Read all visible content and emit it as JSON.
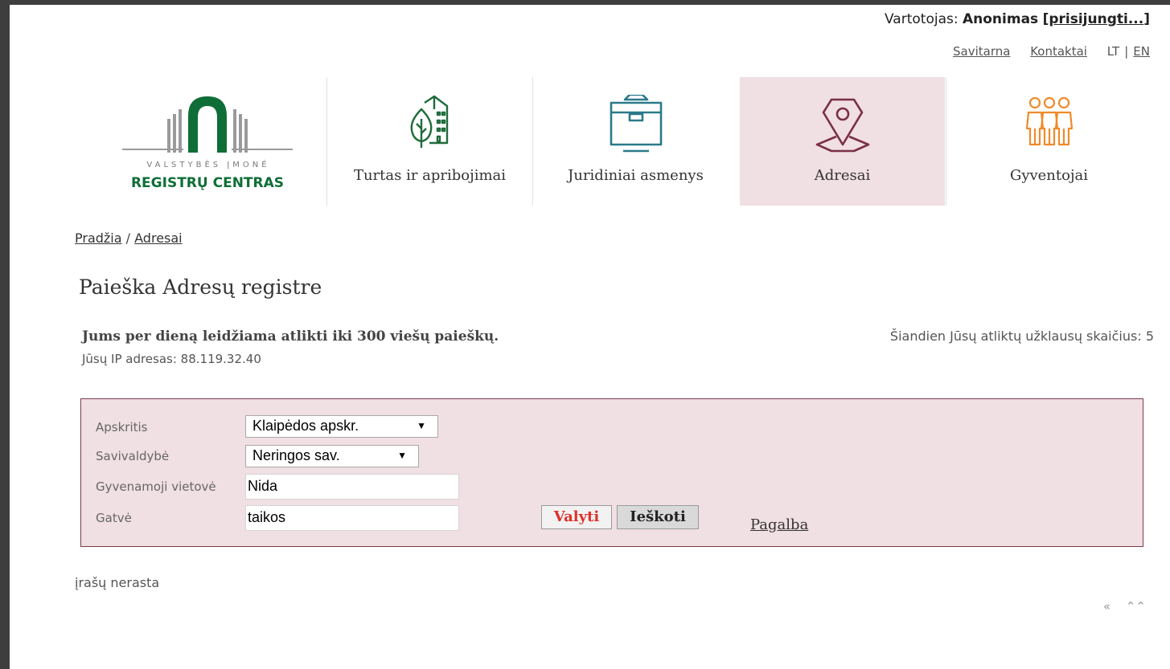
{
  "header": {
    "user_prefix": "Vartotojas:",
    "user_name": "Anonimas",
    "login_link": "prisijungti...",
    "links": {
      "self_service": "Savitarna",
      "contacts": "Kontaktai"
    },
    "lang": {
      "lt": "LT",
      "sep": "|",
      "en": "EN"
    }
  },
  "logo": {
    "line1": "VALSTYBĖS ĮMONĖ",
    "line2": "REGISTRŲ CENTRAS",
    "color": "#0f6e37"
  },
  "nav": [
    {
      "label": "Turtas ir apribojimai",
      "icon": "building-tree-icon",
      "color": "#1e6b3a"
    },
    {
      "label": "Juridiniai asmenys",
      "icon": "briefcase-icon",
      "color": "#2a7a8a"
    },
    {
      "label": "Adresai",
      "icon": "map-pin-icon",
      "color": "#7a2f45",
      "active": true
    },
    {
      "label": "Gyventojai",
      "icon": "people-icon",
      "color": "#f08a2a"
    }
  ],
  "breadcrumb": {
    "home": "Pradžia",
    "sep": "/",
    "current": "Adresai"
  },
  "page_title": "Paieška Adresų registre",
  "info": {
    "limit": "Jums per dieną leidžiama atlikti iki 300 viešų paieškų.",
    "ip": "Jūsų IP adresas: 88.119.32.40",
    "count": "Šiandien Jūsų atliktų užklausų skaičius: 5"
  },
  "form": {
    "county_label": "Apskritis",
    "county_value": "Klaipėdos apskr.",
    "municipality_label": "Savivaldybė",
    "municipality_value": "Neringos sav.",
    "settlement_label": "Gyvenamoji vietovė",
    "settlement_value": "Nida",
    "street_label": "Gatvė",
    "street_value": "taikos",
    "clear_label": "Valyti",
    "search_label": "Ieškoti",
    "help_label": "Pagalba"
  },
  "results": {
    "message": "įrašų nerasta"
  },
  "pager": {
    "first": "«",
    "top": "⌃⌃"
  }
}
